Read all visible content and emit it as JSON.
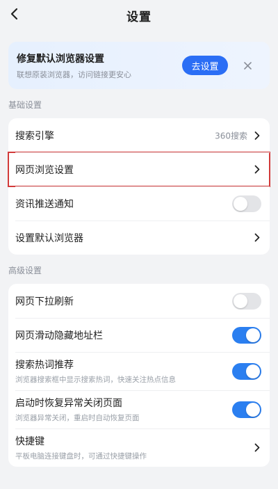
{
  "header": {
    "title": "设置"
  },
  "banner": {
    "title": "修复默认浏览器设置",
    "subtitle": "联想原装浏览器，访问链接更安心",
    "button": "去设置"
  },
  "sections": {
    "basic": "基础设置",
    "advanced": "高级设置"
  },
  "basic_items": [
    {
      "label": "搜索引擎",
      "value": "360搜索"
    },
    {
      "label": "网页浏览设置"
    },
    {
      "label": "资讯推送通知",
      "toggle": "off"
    },
    {
      "label": "设置默认浏览器"
    }
  ],
  "advanced_items": [
    {
      "label": "网页下拉刷新",
      "toggle": "off"
    },
    {
      "label": "网页滑动隐藏地址栏",
      "toggle": "on"
    },
    {
      "label": "搜索热词推荐",
      "sub": "浏览器搜索框中显示搜索热词，快速关注热点信息",
      "toggle": "on"
    },
    {
      "label": "启动时恢复异常关闭页面",
      "sub": "浏览器异常关闭，重启时自动恢复页面",
      "toggle": "on"
    },
    {
      "label": "快捷键",
      "sub": "平板电脑连接键盘时，可通过快捷键操作"
    }
  ],
  "colors": {
    "accent": "#2b7ff0",
    "highlight_border": "#d23a3a"
  },
  "icons": [
    "back-arrow-icon",
    "close-icon",
    "chevron-right-icon"
  ]
}
